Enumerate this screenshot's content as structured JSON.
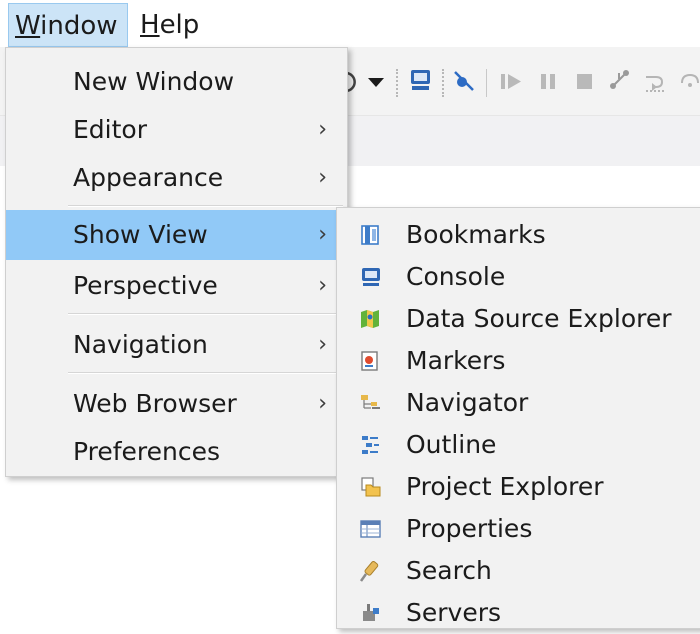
{
  "menubar": {
    "items": [
      {
        "label": "Window",
        "mnemonic": "W",
        "rest": "indow"
      },
      {
        "label": "Help",
        "mnemonic": "H",
        "rest": "elp"
      }
    ]
  },
  "window_menu": {
    "items": [
      {
        "label": "New Window",
        "submenu": false
      },
      {
        "label": "Editor",
        "submenu": true
      },
      {
        "label": "Appearance",
        "submenu": true
      },
      {
        "label": "Show View",
        "submenu": true,
        "selected": true
      },
      {
        "label": "Perspective",
        "submenu": true
      },
      {
        "label": "Navigation",
        "submenu": true
      },
      {
        "label": "Web Browser",
        "submenu": true
      },
      {
        "label": "Preferences",
        "submenu": false
      }
    ],
    "chevron": "›"
  },
  "show_view_menu": {
    "items": [
      {
        "label": "Bookmarks",
        "icon": "bookmarks-icon"
      },
      {
        "label": "Console",
        "icon": "console-icon"
      },
      {
        "label": "Data Source Explorer",
        "icon": "data-source-explorer-icon"
      },
      {
        "label": "Markers",
        "icon": "markers-icon"
      },
      {
        "label": "Navigator",
        "icon": "navigator-icon"
      },
      {
        "label": "Outline",
        "icon": "outline-icon"
      },
      {
        "label": "Project Explorer",
        "icon": "project-explorer-icon"
      },
      {
        "label": "Properties",
        "icon": "properties-icon"
      },
      {
        "label": "Search",
        "icon": "search-icon"
      },
      {
        "label": "Servers",
        "icon": "servers-icon"
      }
    ]
  },
  "colors": {
    "selected": "#91c9f7",
    "menu_bg": "#f2f2f2",
    "menubar_active": "#cce4f7"
  }
}
